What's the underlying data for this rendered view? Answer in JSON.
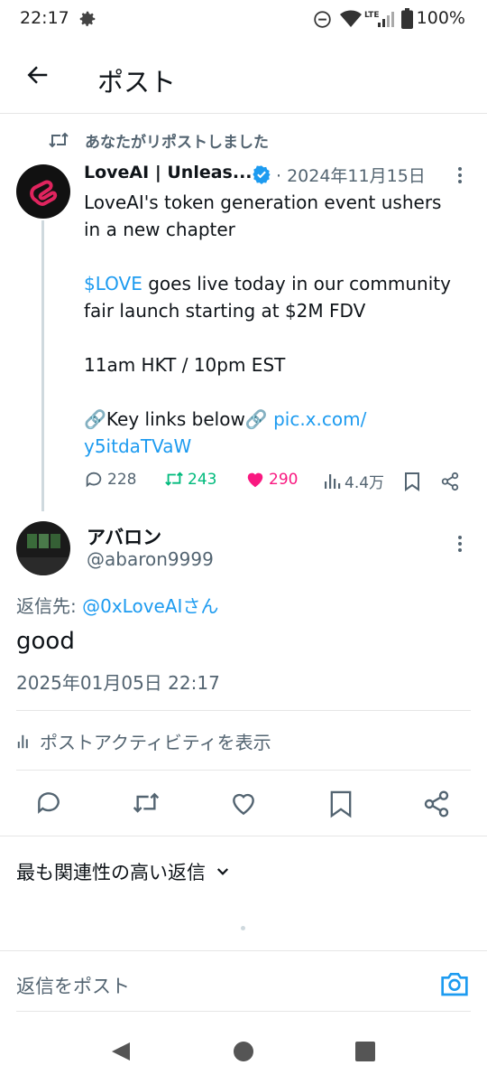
{
  "status": {
    "time": "22:17",
    "network": "LTE",
    "battery": "100%",
    "icons": [
      "gear-icon",
      "dnd-icon",
      "wifi-icon",
      "signal-icon",
      "battery-icon"
    ]
  },
  "header": {
    "back_icon": "arrow-left-icon",
    "title": "ポスト"
  },
  "repost_label": "あなたがリポストしました",
  "original": {
    "name": "LoveAI | Unleas...",
    "verified_icon": "verified-badge-icon",
    "date": "· 2024年11月15日",
    "lines": [
      "LoveAI's token generation event ushers",
      "in a new chapter",
      "",
      "$LOVE goes live today in our community",
      "fair launch starting at $2M FDV",
      "",
      "11am HKT / 10pm EST",
      "",
      "🔗Key links below🔗 pic.x.com/",
      "y5itdaTVaW"
    ],
    "line3_cashtag": "$LOVE",
    "line3_rest": " goes live today in our community",
    "line8_text": "🔗Key links below🔗 ",
    "line8_link": "pic.x.com/",
    "stats": {
      "replies": "228",
      "reposts": "243",
      "likes": "290",
      "views": "4.4万"
    }
  },
  "reply": {
    "name": "アバロン",
    "handle": "@abaron9999",
    "replying_prefix": "返信先: ",
    "replying_to": "@0xLoveAIさん",
    "text": "good",
    "timestamp": "2025年01月05日 22:17"
  },
  "activity_label": "ポストアクティビティを表示",
  "sort_label": "最も関連性の高い返信",
  "reply_placeholder": "返信をポスト",
  "colors": {
    "blue": "#1d9bf0",
    "green": "#00ba7c",
    "pink": "#f91880",
    "gray": "#536471"
  }
}
